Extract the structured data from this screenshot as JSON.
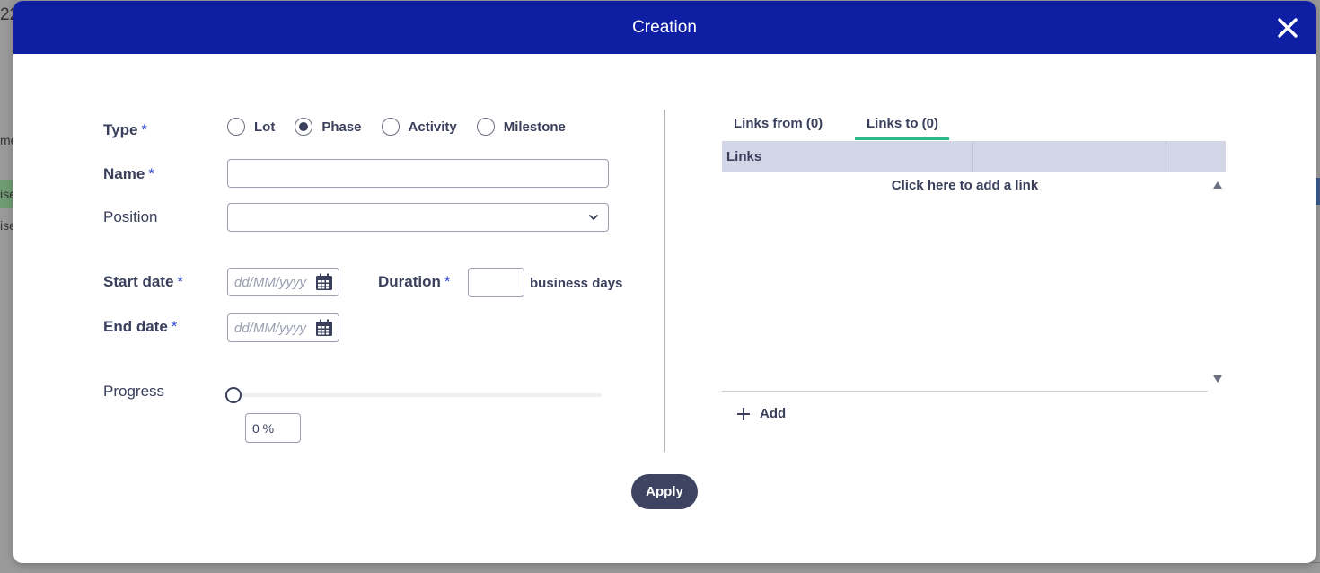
{
  "background": {
    "frag_top": "22",
    "frag_mid": "me",
    "frag_row1": "ise",
    "frag_row2": "ise"
  },
  "dialog": {
    "title": "Creation"
  },
  "form": {
    "type_label": "Type",
    "required_mark": "*",
    "type_options": [
      {
        "label": "Lot",
        "checked": false
      },
      {
        "label": "Phase",
        "checked": true
      },
      {
        "label": "Activity",
        "checked": false
      },
      {
        "label": "Milestone",
        "checked": false
      }
    ],
    "name_label": "Name",
    "name_value": "",
    "position_label": "Position",
    "position_value": "",
    "start_date_label": "Start date",
    "start_date_placeholder": "dd/MM/yyyy",
    "duration_label": "Duration",
    "duration_value": "",
    "duration_unit": "business days",
    "end_date_label": "End date",
    "end_date_placeholder": "dd/MM/yyyy",
    "progress_label": "Progress",
    "progress_value": "0 %",
    "progress_fraction": 0
  },
  "links": {
    "tabs": [
      {
        "label": "Links from (0)",
        "active": false
      },
      {
        "label": "Links to (0)",
        "active": true
      }
    ],
    "column_header": "Links",
    "add_link_prompt": "Click here to add a link",
    "add_label": "Add"
  },
  "actions": {
    "apply_label": "Apply"
  },
  "colors": {
    "header_bg": "#0e1fa3",
    "required": "#2f47d6",
    "tab_active_underline": "#2fb88a",
    "apply_bg": "#3d4361"
  }
}
